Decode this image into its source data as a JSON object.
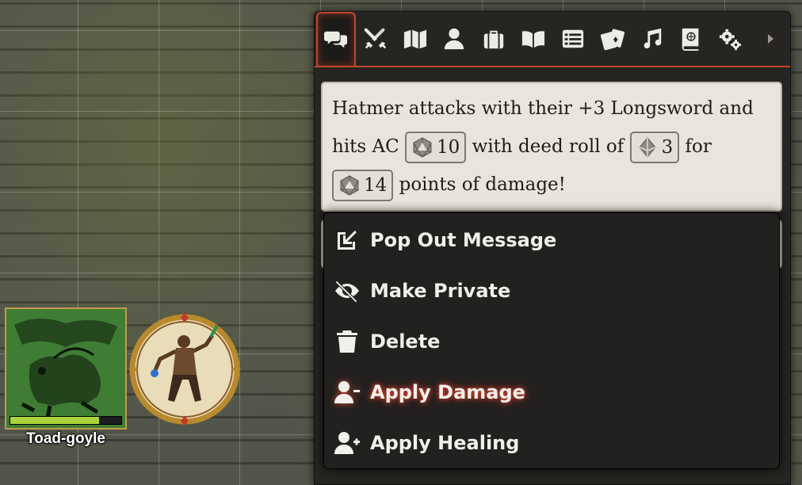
{
  "map": {
    "tokens": [
      {
        "name": "Toad-goyle",
        "hp_fraction": 0.8
      }
    ]
  },
  "sidebar": {
    "tabs": [
      {
        "name": "chat",
        "icon": "comments-icon",
        "active": true
      },
      {
        "name": "combat",
        "icon": "crossed-swords-icon"
      },
      {
        "name": "scenes",
        "icon": "map-icon"
      },
      {
        "name": "actors",
        "icon": "user-icon"
      },
      {
        "name": "items",
        "icon": "suitcase-icon"
      },
      {
        "name": "journal",
        "icon": "book-open-icon"
      },
      {
        "name": "tables",
        "icon": "list-icon"
      },
      {
        "name": "cards",
        "icon": "cards-icon"
      },
      {
        "name": "playlists",
        "icon": "music-icon"
      },
      {
        "name": "compendium",
        "icon": "atlas-icon"
      },
      {
        "name": "settings",
        "icon": "cogs-icon"
      },
      {
        "name": "collapse",
        "icon": "caret-right-icon"
      }
    ]
  },
  "message": {
    "part1": "Hatmer attacks with their +3 Longsword and hits AC",
    "ac_value": "10",
    "part2": "with deed roll of",
    "deed_value": "3",
    "part3": "for",
    "damage_value": "14",
    "part4": "points of damage!"
  },
  "context_menu": {
    "items": [
      {
        "label": "Pop Out Message",
        "icon": "external-link-icon"
      },
      {
        "label": "Make Private",
        "icon": "eye-slash-icon"
      },
      {
        "label": "Delete",
        "icon": "trash-icon"
      },
      {
        "label": "Apply Damage",
        "icon": "user-minus-icon",
        "highlighted": true
      },
      {
        "label": "Apply Healing",
        "icon": "user-plus-icon"
      }
    ],
    "highlight_color": "#d1432d"
  }
}
